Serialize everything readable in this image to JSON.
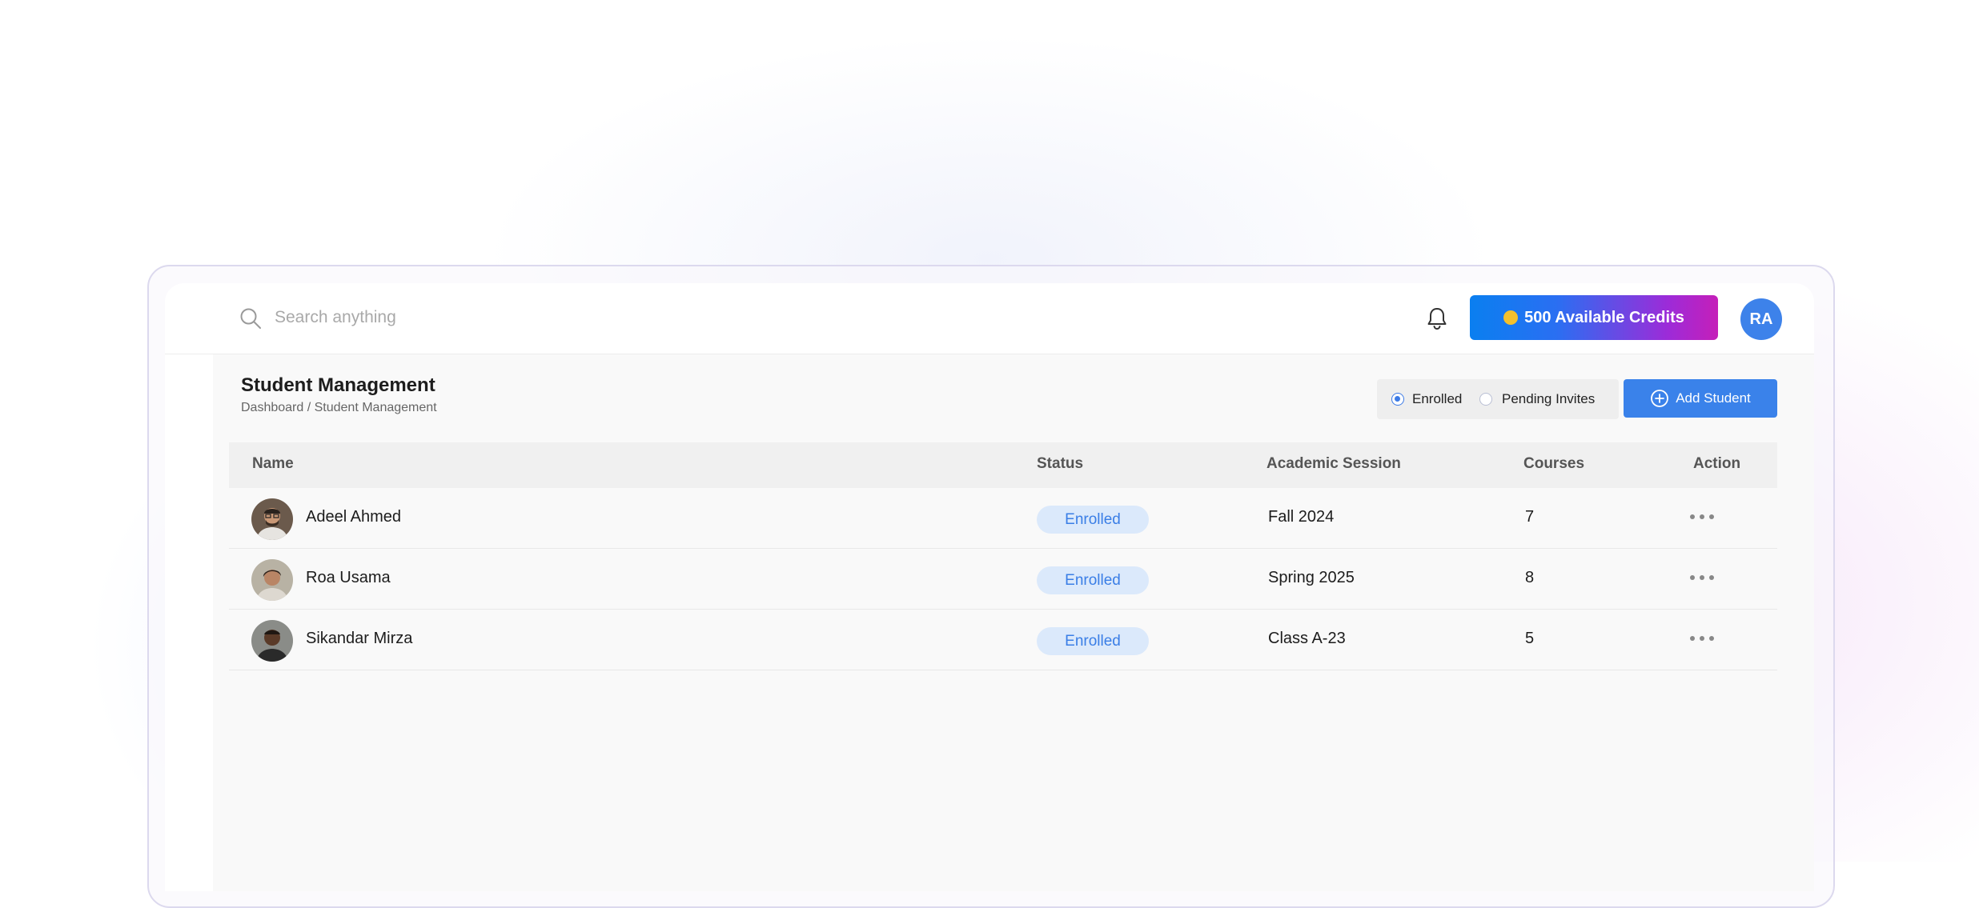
{
  "search": {
    "placeholder": "Search anything"
  },
  "header": {
    "credits_label": "500 Available Credits",
    "user_initials": "RA"
  },
  "page": {
    "title": "Student Management",
    "breadcrumb": "Dashboard / Student Management"
  },
  "filters": {
    "enrolled_label": "Enrolled",
    "pending_label": "Pending Invites",
    "selected": "Enrolled"
  },
  "actions": {
    "add_student_label": "Add Student"
  },
  "table": {
    "columns": [
      "Name",
      "Status",
      "Academic Session",
      "Courses",
      "Action"
    ],
    "rows": [
      {
        "name": "Adeel Ahmed",
        "status": "Enrolled",
        "session": "Fall 2024",
        "courses": "7"
      },
      {
        "name": "Roa Usama",
        "status": "Enrolled",
        "session": "Spring 2025",
        "courses": "8"
      },
      {
        "name": "Sikandar Mirza",
        "status": "Enrolled",
        "session": "Class A-23",
        "courses": "5"
      }
    ]
  },
  "colors": {
    "primary": "#3a82ea",
    "badge_bg": "#dbe9fb",
    "credits_gradient_start": "#0a7ff0",
    "credits_gradient_end": "#c51fb9"
  },
  "icons": [
    "search-icon",
    "bell-icon",
    "coin-icon",
    "plus-circle-icon",
    "more-horizontal-icon"
  ]
}
